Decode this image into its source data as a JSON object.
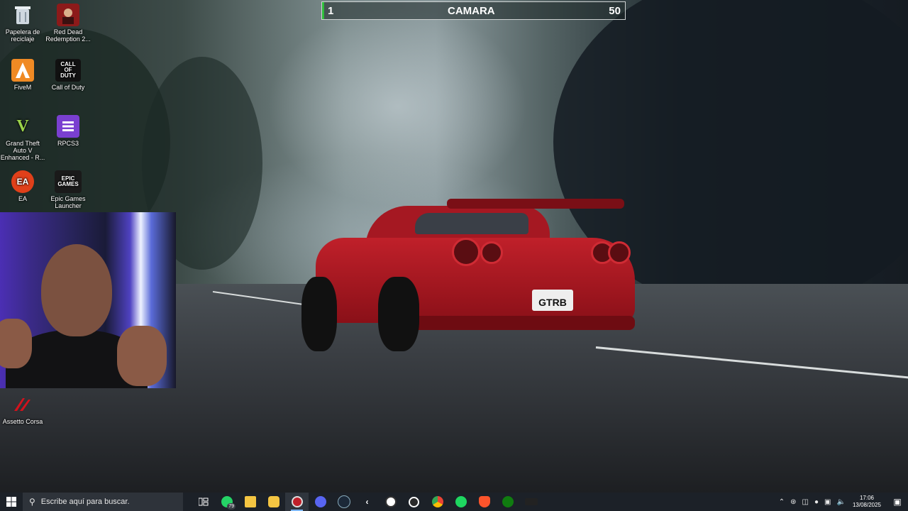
{
  "desktop_icons": [
    {
      "label": "Papelera de reciclaje",
      "glyph": "",
      "color": "#a7b3bd"
    },
    {
      "label": "Red Dead Redemption 2...",
      "glyph": "",
      "color": "#9a1c1c"
    },
    {
      "label": "FiveM",
      "glyph": "",
      "color": "#f08a24"
    },
    {
      "label": "Call of Duty",
      "glyph": "CALL OF DUTY",
      "color": "#111111"
    },
    {
      "label": "Grand Theft Auto V Enhanced - R...",
      "glyph": "V",
      "color": "#2f4d2a"
    },
    {
      "label": "RPCS3",
      "glyph": "",
      "color": "#7a3fd0"
    },
    {
      "label": "EA",
      "glyph": "EA",
      "color": "#e0401a"
    },
    {
      "label": "Epic Games Launcher",
      "glyph": "EPIC GAMES",
      "color": "#1a1a1a"
    },
    {
      "label": "Assetto Corsa",
      "glyph": "",
      "color": "#c2121c"
    }
  ],
  "camara_bar": {
    "left_value": "1",
    "title": "CAMARA",
    "right_value": "50"
  },
  "car": {
    "plate": "GTRB"
  },
  "taskbar": {
    "search_placeholder": "Escribe aquí para buscar.",
    "whatsapp_badge": "79",
    "apps": [
      "task-view",
      "whatsapp",
      "file-explorer",
      "microsoft-store",
      "recording-app",
      "discord",
      "steam",
      "epic-games",
      "rockstar",
      "obs",
      "chrome",
      "spotify",
      "brave",
      "xbox",
      "nvidia"
    ],
    "clock_time": "17:06",
    "clock_date": "13/08/2025"
  }
}
